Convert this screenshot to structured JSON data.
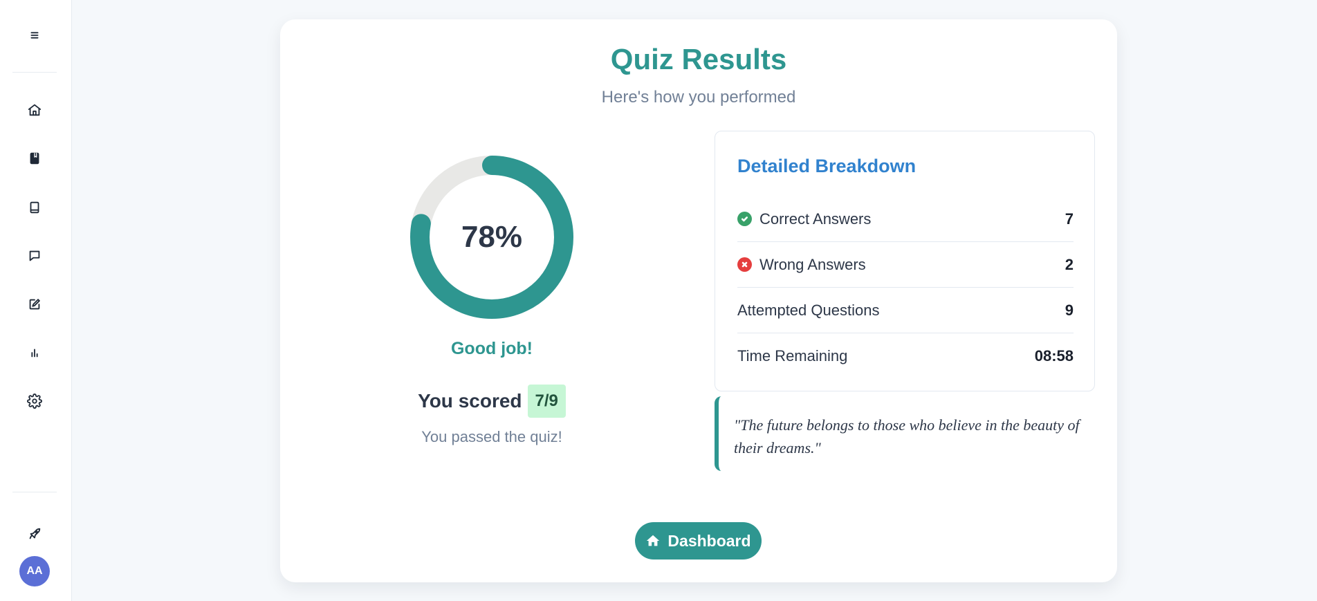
{
  "sidebar": {
    "icons": [
      "menu-icon",
      "home-icon",
      "bookmark-book-icon",
      "book-icon",
      "chat-icon",
      "edit-icon",
      "bar-chart-icon",
      "gear-icon",
      "rocket-icon"
    ],
    "avatar_initials": "AA"
  },
  "header": {
    "title": "Quiz Results",
    "subtitle": "Here's how you performed"
  },
  "score": {
    "percent": 78,
    "percent_label": "78%",
    "message": "Good job!",
    "scored_label": "You scored",
    "score_badge": "7/9",
    "status_text": "You passed the quiz!"
  },
  "breakdown": {
    "title": "Detailed Breakdown",
    "rows": [
      {
        "label": "Correct Answers",
        "value": "7",
        "icon": "check-circle-icon"
      },
      {
        "label": "Wrong Answers",
        "value": "2",
        "icon": "x-circle-icon"
      },
      {
        "label": "Attempted Questions",
        "value": "9"
      },
      {
        "label": "Time Remaining",
        "value": "08:58"
      }
    ]
  },
  "quote": {
    "text": "\"The future belongs to those who believe in the beauty of their dreams.\""
  },
  "actions": {
    "dashboard_label": "Dashboard"
  },
  "colors": {
    "accent": "#2e9690",
    "ring_track": "#e8e8e6",
    "breakdown_title": "#3182ce",
    "correct": "#38a169",
    "wrong": "#e53e3e",
    "badge_bg": "#c6f6d5",
    "avatar_bg": "#5b6fd6"
  }
}
